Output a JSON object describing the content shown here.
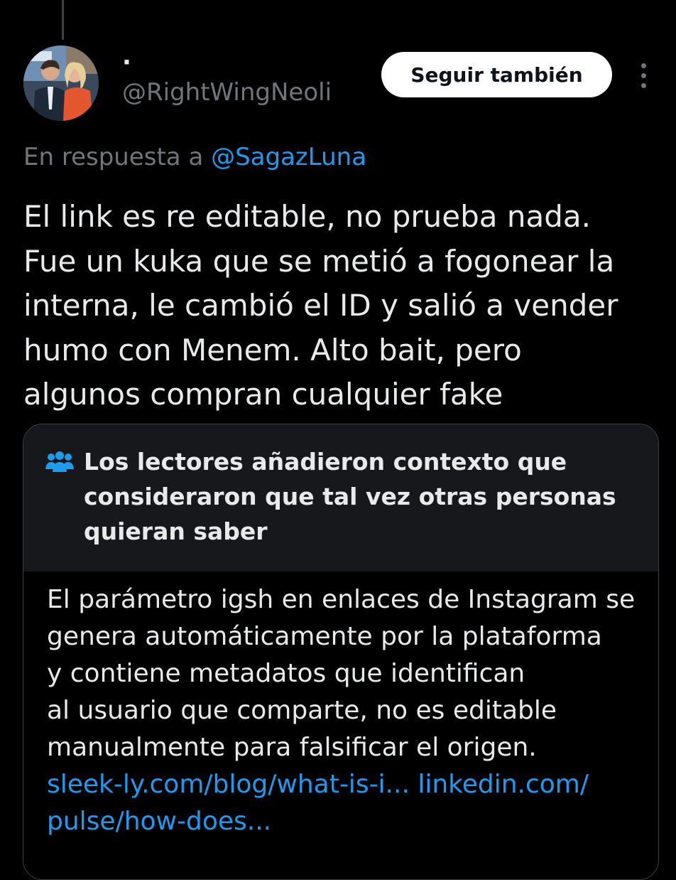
{
  "post": {
    "display_name": "·",
    "handle": "@RightWingNeoli",
    "follow_label": "Seguir también",
    "reply_prefix": "En respuesta a",
    "reply_mention": "@SagazLuna",
    "text_lines": [
      "El link es re editable, no prueba nada.",
      "Fue un kuka que se metió a fogonear la",
      "interna, le cambió el ID y salió a vender",
      "humo con Menem. Alto bait, pero",
      "algunos compran cualquier fake"
    ]
  },
  "community_note": {
    "icon": "people-icon",
    "title_lines": [
      "Los lectores añadieron contexto que",
      "consideraron que tal vez otras personas",
      "quieran saber"
    ],
    "body_lines": [
      "El parámetro igsh en enlaces de Instagram se",
      "genera automáticamente por la plataforma",
      "y contiene metadatos que identifican",
      "al usuario que comparte, no es editable",
      "manualmente para falsificar el origen."
    ],
    "link_1": "sleek-ly.com/blog/what-is-i...",
    "link_2_part1": "linkedin.com/",
    "link_2_part2": "pulse/how-does..."
  },
  "colors": {
    "background": "#000000",
    "text_primary": "#e7e9ea",
    "text_secondary": "#71767b",
    "link": "#1d9bf0",
    "note_header_bg": "#16181c",
    "border": "#3e4144",
    "button_bg": "#ffffff"
  }
}
